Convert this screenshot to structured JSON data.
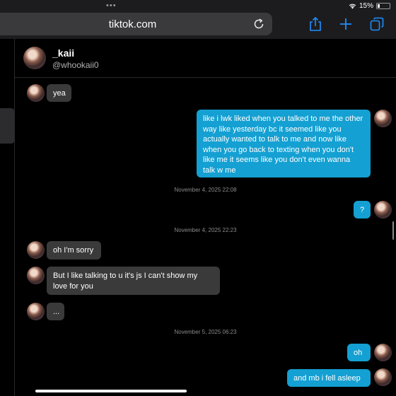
{
  "browser": {
    "url": "tiktok.com",
    "battery": "15%",
    "icons": {
      "top_dots": "more-dots-icon",
      "wifi": "wifi-icon",
      "battery": "battery-icon",
      "reload": "reload-icon",
      "share": "share-icon",
      "new_tab": "plus-icon",
      "tabs": "tabs-icon"
    }
  },
  "chat": {
    "contact_name": "_kaii",
    "contact_handle": "@whookaii0",
    "messages": [
      {
        "type": "received",
        "text": "yea"
      },
      {
        "type": "sent",
        "text": "like i lwk liked when you talked to me the other way like yesterday bc it seemed like you actually wanted to talk to me and now like when you go back to texting when you don't like me it seems like you don't even wanna talk w me"
      },
      {
        "type": "timestamp",
        "text": "November 4, 2025 22:08"
      },
      {
        "type": "sent",
        "text": "?"
      },
      {
        "type": "timestamp",
        "text": "November 4, 2025 22:23"
      },
      {
        "type": "received",
        "text": "oh I'm sorry"
      },
      {
        "type": "received",
        "text": "But I like talking to u it's js I can't show my love for you"
      },
      {
        "type": "received",
        "text": "..."
      },
      {
        "type": "timestamp",
        "text": "November 5, 2025 06:23"
      },
      {
        "type": "sent",
        "text": "oh"
      },
      {
        "type": "sent",
        "text": "and mb i fell asleep"
      }
    ]
  },
  "colors": {
    "sent_bubble": "#14a0d2",
    "received_bubble": "#3a3a3a",
    "background": "#000000"
  }
}
